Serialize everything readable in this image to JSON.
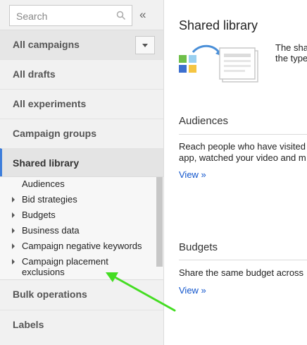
{
  "search": {
    "placeholder": "Search"
  },
  "sidebar": {
    "items": [
      {
        "label": "All campaigns"
      },
      {
        "label": "All drafts"
      },
      {
        "label": "All experiments"
      },
      {
        "label": "Campaign groups"
      },
      {
        "label": "Shared library"
      },
      {
        "label": "Bulk operations"
      },
      {
        "label": "Labels"
      }
    ],
    "shared_library_children": [
      {
        "label": "Audiences",
        "expandable": false
      },
      {
        "label": "Bid strategies",
        "expandable": true
      },
      {
        "label": "Budgets",
        "expandable": true
      },
      {
        "label": "Business data",
        "expandable": true
      },
      {
        "label": "Campaign negative keywords",
        "expandable": true
      },
      {
        "label": "Campaign placement exclusions",
        "expandable": true
      }
    ],
    "selected": "Shared library"
  },
  "main": {
    "title": "Shared library",
    "intro_lines": [
      "The sha",
      "the type"
    ],
    "sections": [
      {
        "title": "Audiences",
        "description_lines": [
          "Reach people who have visited",
          "app, watched your video and m"
        ],
        "link": "View »"
      },
      {
        "title": "Budgets",
        "description_lines": [
          "Share the same budget across"
        ],
        "link": "View »"
      }
    ]
  },
  "colors": {
    "accent": "#3d7ddb",
    "link": "#1155cc",
    "annotation_arrow": "#44dd22",
    "sidebar_bg": "#f1f1f1"
  },
  "icons": [
    "search-icon",
    "collapse-double-chevron-icon",
    "dropdown-caret-icon",
    "expand-triangle-icon",
    "shared-library-illustration"
  ]
}
